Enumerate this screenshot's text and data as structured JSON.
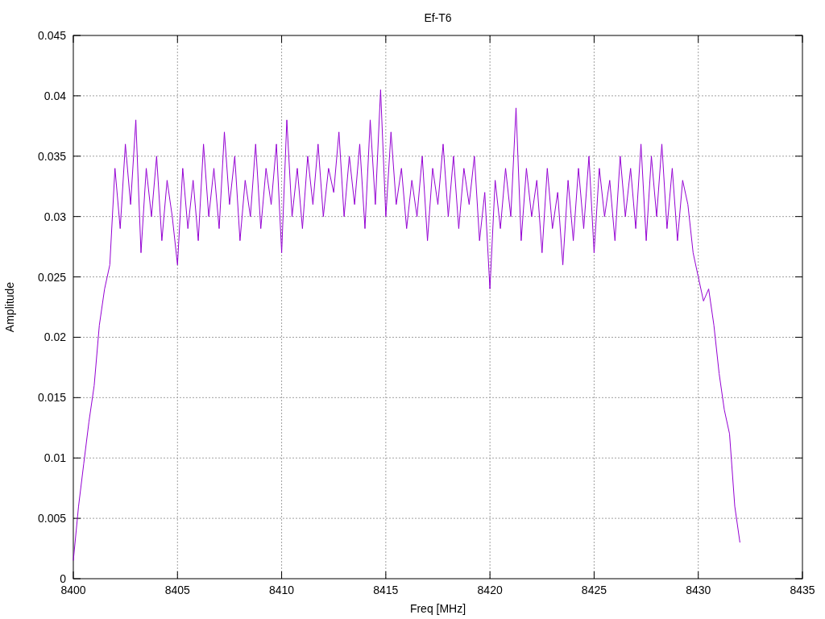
{
  "chart_data": {
    "type": "line",
    "grid": true,
    "title": "Ef-T6",
    "xlabel": "Freq [MHz]",
    "ylabel": "Amplitude",
    "xlim": [
      8400,
      8435
    ],
    "ylim": [
      0,
      0.045
    ],
    "xticks": [
      8400,
      8405,
      8410,
      8415,
      8420,
      8425,
      8430,
      8435
    ],
    "yticks": [
      0,
      0.005,
      0.01,
      0.015,
      0.02,
      0.025,
      0.03,
      0.035,
      0.04,
      0.045
    ],
    "x": [
      8400,
      8400.25,
      8400.5,
      8400.75,
      8401,
      8401.25,
      8401.5,
      8401.75,
      8402,
      8402.25,
      8402.5,
      8402.75,
      8403,
      8403.25,
      8403.5,
      8403.75,
      8404,
      8404.25,
      8404.5,
      8404.75,
      8405,
      8405.25,
      8405.5,
      8405.75,
      8406,
      8406.25,
      8406.5,
      8406.75,
      8407,
      8407.25,
      8407.5,
      8407.75,
      8408,
      8408.25,
      8408.5,
      8408.75,
      8409,
      8409.25,
      8409.5,
      8409.75,
      8410,
      8410.25,
      8410.5,
      8410.75,
      8411,
      8411.25,
      8411.5,
      8411.75,
      8412,
      8412.25,
      8412.5,
      8412.75,
      8413,
      8413.25,
      8413.5,
      8413.75,
      8414,
      8414.25,
      8414.5,
      8414.75,
      8415,
      8415.25,
      8415.5,
      8415.75,
      8416,
      8416.25,
      8416.5,
      8416.75,
      8417,
      8417.25,
      8417.5,
      8417.75,
      8418,
      8418.25,
      8418.5,
      8418.75,
      8419,
      8419.25,
      8419.5,
      8419.75,
      8420,
      8420.25,
      8420.5,
      8420.75,
      8421,
      8421.25,
      8421.5,
      8421.75,
      8422,
      8422.25,
      8422.5,
      8422.75,
      8423,
      8423.25,
      8423.5,
      8423.75,
      8424,
      8424.25,
      8424.5,
      8424.75,
      8425,
      8425.25,
      8425.5,
      8425.75,
      8426,
      8426.25,
      8426.5,
      8426.75,
      8427,
      8427.25,
      8427.5,
      8427.75,
      8428,
      8428.25,
      8428.5,
      8428.75,
      8429,
      8429.25,
      8429.5,
      8429.75,
      8430,
      8430.25,
      8430.5,
      8430.75,
      8431,
      8431.25,
      8431.5,
      8431.75,
      8432
    ],
    "series": [
      {
        "color": "#9400d3",
        "values": [
          0.0015,
          0.006,
          0.0095,
          0.013,
          0.016,
          0.021,
          0.024,
          0.026,
          0.034,
          0.029,
          0.036,
          0.031,
          0.038,
          0.027,
          0.034,
          0.03,
          0.035,
          0.028,
          0.033,
          0.03,
          0.026,
          0.034,
          0.029,
          0.033,
          0.028,
          0.036,
          0.03,
          0.034,
          0.029,
          0.037,
          0.031,
          0.035,
          0.028,
          0.033,
          0.03,
          0.036,
          0.029,
          0.034,
          0.031,
          0.036,
          0.027,
          0.038,
          0.03,
          0.034,
          0.029,
          0.035,
          0.031,
          0.036,
          0.03,
          0.034,
          0.032,
          0.037,
          0.03,
          0.035,
          0.031,
          0.036,
          0.029,
          0.038,
          0.031,
          0.0405,
          0.03,
          0.037,
          0.031,
          0.034,
          0.029,
          0.033,
          0.03,
          0.035,
          0.028,
          0.034,
          0.031,
          0.036,
          0.03,
          0.035,
          0.029,
          0.034,
          0.031,
          0.035,
          0.028,
          0.032,
          0.024,
          0.033,
          0.029,
          0.034,
          0.03,
          0.039,
          0.028,
          0.034,
          0.03,
          0.033,
          0.027,
          0.034,
          0.029,
          0.032,
          0.026,
          0.033,
          0.028,
          0.034,
          0.029,
          0.035,
          0.027,
          0.034,
          0.03,
          0.033,
          0.028,
          0.035,
          0.03,
          0.034,
          0.029,
          0.036,
          0.028,
          0.035,
          0.03,
          0.036,
          0.029,
          0.034,
          0.028,
          0.033,
          0.031,
          0.027,
          0.025,
          0.023,
          0.024,
          0.021,
          0.017,
          0.014,
          0.012,
          0.006,
          0.003
        ]
      }
    ]
  }
}
